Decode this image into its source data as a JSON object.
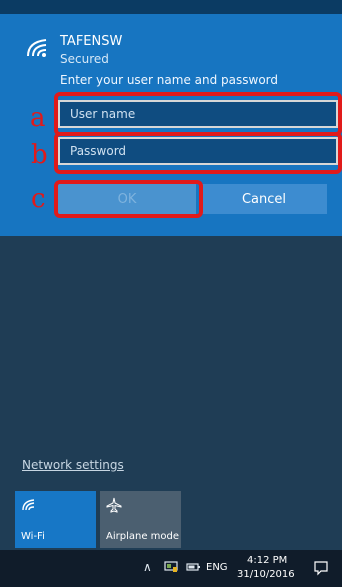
{
  "network": {
    "ssid": "TAFENSW",
    "status": "Secured",
    "prompt": "Enter your user name and password"
  },
  "form": {
    "username_placeholder": "User name",
    "username_value": "",
    "password_placeholder": "Password",
    "password_value": ""
  },
  "buttons": {
    "ok": "OK",
    "cancel": "Cancel"
  },
  "annotations": {
    "a": "a",
    "b": "b",
    "c": "c"
  },
  "links": {
    "network_settings": "Network settings"
  },
  "tiles": [
    {
      "label": "Wi-Fi",
      "icon": "wifi-icon"
    },
    {
      "label": "Airplane mode",
      "icon": "airplane-icon"
    }
  ],
  "taskbar": {
    "language": "ENG",
    "time": "4:12 PM",
    "date": "31/10/2016"
  },
  "colors": {
    "panel": "#1775c1",
    "annotation": "#e11a1a"
  }
}
